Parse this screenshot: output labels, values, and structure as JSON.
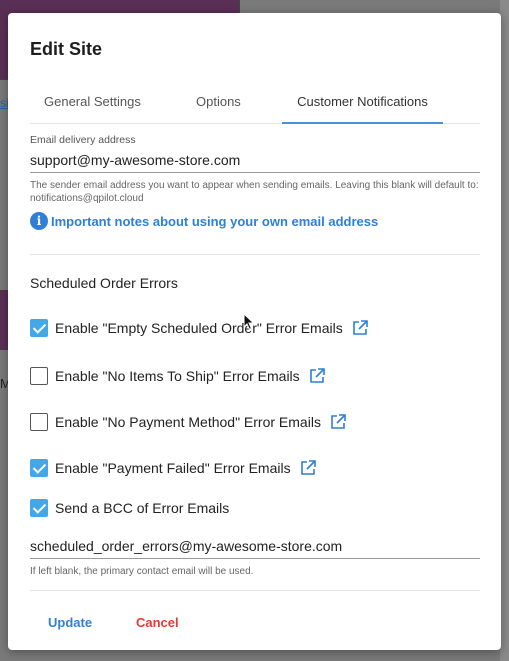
{
  "background": {
    "link_text": "si",
    "letter": "M"
  },
  "modal": {
    "title": "Edit Site",
    "tabs": [
      {
        "label": "General Settings",
        "active": false
      },
      {
        "label": "Options",
        "active": false
      },
      {
        "label": "Customer Notifications",
        "active": true
      }
    ]
  },
  "email": {
    "label": "Email delivery address",
    "value": "support@my-awesome-store.com",
    "help": "The sender email address you want to appear when sending emails. Leaving this blank will default to: notifications@qpilot.cloud"
  },
  "info": {
    "icon": "info-icon",
    "glyph": "i",
    "link": "Important notes about using your own email address"
  },
  "scheduled_order_errors": {
    "title": "Scheduled Order Errors",
    "options": [
      {
        "label": "Enable \"Empty Scheduled Order\" Error Emails",
        "checked": true,
        "external_link": true
      },
      {
        "label": "Enable \"No Items To Ship\" Error Emails",
        "checked": false,
        "external_link": true
      },
      {
        "label": "Enable \"No Payment Method\" Error Emails",
        "checked": false,
        "external_link": true
      },
      {
        "label": "Enable \"Payment Failed\" Error Emails",
        "checked": true,
        "external_link": true
      },
      {
        "label": "Send a BCC of Error Emails",
        "checked": true,
        "external_link": false
      }
    ],
    "bcc_value": "scheduled_order_errors@my-awesome-store.com",
    "bcc_help": "If left blank, the primary contact email will be used."
  },
  "actions": {
    "update": "Update",
    "cancel": "Cancel"
  },
  "colors": {
    "accent": "#2f7fd6",
    "checkbox": "#45a8e6",
    "cancel": "#e53935"
  }
}
